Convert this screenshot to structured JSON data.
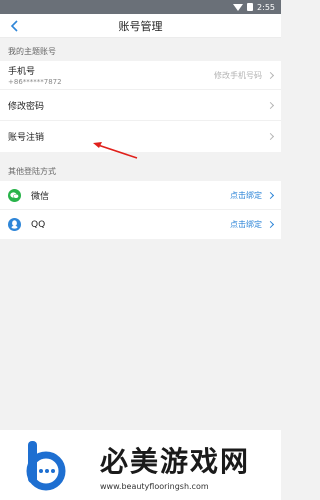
{
  "status_bar": {
    "time": "2:55"
  },
  "nav": {
    "title": "账号管理"
  },
  "my_account": {
    "section_title": "我的主题账号",
    "phone": {
      "label": "手机号",
      "number": "+86******7872",
      "action": "修改手机号码"
    },
    "password": {
      "label": "修改密码"
    },
    "cancel": {
      "label": "账号注销"
    }
  },
  "other_login": {
    "section_title": "其他登陆方式",
    "items": [
      {
        "label": "微信",
        "action": "点击绑定",
        "icon": "wechat-icon",
        "color": "#28b34a"
      },
      {
        "label": "QQ",
        "action": "点击绑定",
        "icon": "qq-icon",
        "color": "#2f86d8"
      }
    ]
  },
  "watermark": {
    "title": "必美游戏网",
    "url": "www.beautyflooringsh.com"
  },
  "colors": {
    "link": "#2f86d8",
    "arrow": "#e0201b"
  }
}
